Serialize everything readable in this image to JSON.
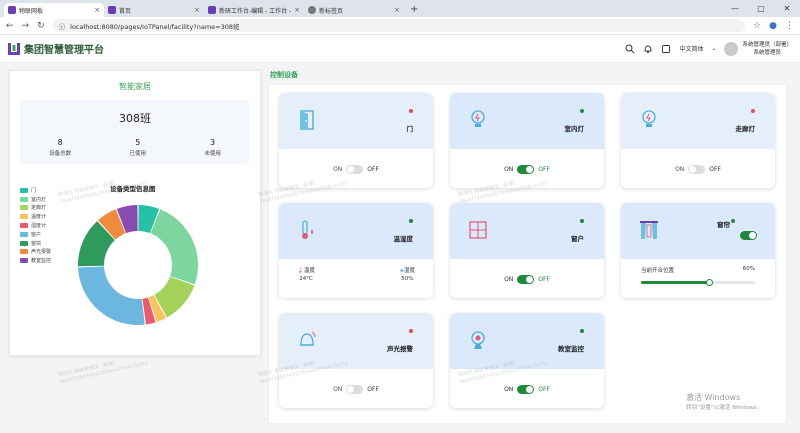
{
  "browser": {
    "tabs": [
      {
        "title": "物联网板",
        "active": true,
        "color": "#6a3fb5"
      },
      {
        "title": "首页",
        "active": false,
        "color": "#6a3fb5"
      },
      {
        "title": "新研工作台-编辑 - 工作台 - 在",
        "active": false,
        "color": "#6a3fb5"
      },
      {
        "title": "新标签页",
        "active": false,
        "color": "#777777"
      }
    ],
    "url": "localhost:8080/pages/IoTPanel/facility?name=308班"
  },
  "header": {
    "app_title": "集团智慧管理平台",
    "language": "中文简体",
    "user_name": "系统管理员（部署）",
    "user_role": "系统管理员"
  },
  "left": {
    "title": "智能家居",
    "room": "308班",
    "stats": [
      {
        "value": "8",
        "label": "设备总数"
      },
      {
        "value": "5",
        "label": "已使用"
      },
      {
        "value": "3",
        "label": "未使用"
      }
    ],
    "chart_title": "设备类型信息图"
  },
  "chart_data": {
    "type": "pie",
    "title": "设备类型信息图",
    "legend_position": "left",
    "categories": [
      "门",
      "室内灯",
      "走廊灯",
      "温度计",
      "湿度计",
      "窗户",
      "窗帘",
      "声光报警",
      "教室监控"
    ],
    "values": [
      6,
      25,
      12,
      3,
      3,
      27,
      14,
      6,
      6
    ],
    "colors": [
      "#26c2a8",
      "#7dd6a0",
      "#a5d25a",
      "#f6c35c",
      "#ef5a6b",
      "#6cb7e0",
      "#2e9a5c",
      "#f08a3e",
      "#8a4bb0"
    ]
  },
  "section_title": "控制设备",
  "devices": [
    {
      "name": "门",
      "status_color": "#e05050",
      "on_label": "ON",
      "off_label": "OFF",
      "state": "off"
    },
    {
      "name": "室内灯",
      "status_color": "#1e8a3e",
      "on_label": "ON",
      "off_label": "OFF",
      "state": "on"
    },
    {
      "name": "走廊灯",
      "status_color": "#e05050",
      "on_label": "ON",
      "off_label": "OFF",
      "state": "off"
    },
    {
      "name": "温湿度",
      "status_color": "#1e8a3e",
      "temp_label": "温度",
      "temp_value": "24°C",
      "hum_label": "湿度",
      "hum_value": "50%"
    },
    {
      "name": "窗户",
      "status_color": "#1e8a3e",
      "on_label": "ON",
      "off_label": "OFF",
      "state": "on"
    },
    {
      "name": "窗帘",
      "status_color": "#1e8a3e",
      "position_label": "当前开合位置",
      "position_value": "60%",
      "position": 0.6
    },
    {
      "name": "声光报警",
      "status_color": "#e05050",
      "on_label": "ON",
      "off_label": "OFF",
      "state": "off"
    },
    {
      "name": "教室监控",
      "status_color": "#1e8a3e",
      "on_label": "ON",
      "off_label": "OFF",
      "state": "on"
    }
  ],
  "watermark": {
    "line1": "管理员 系统管理员（部署）",
    "line2": "3ba5f78654456288eea5f7a8c2b7bf"
  },
  "os_notice": {
    "line1": "激活 Windows",
    "line2": "转到“设置”以激活 Windows。"
  }
}
